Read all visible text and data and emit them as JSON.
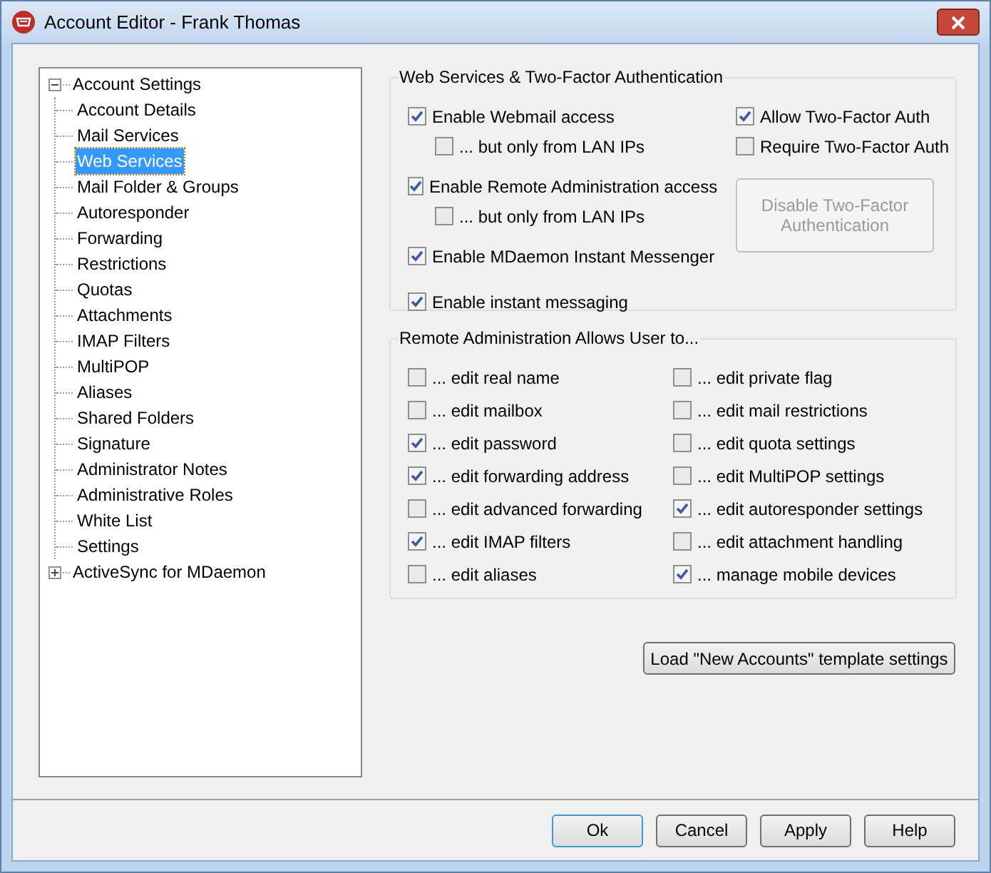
{
  "window": {
    "title": "Account Editor - Frank Thomas"
  },
  "tree": [
    {
      "label": "Account Settings",
      "expanded": true,
      "children": [
        {
          "label": "Account Details",
          "selected": false
        },
        {
          "label": "Mail Services",
          "selected": false
        },
        {
          "label": "Web Services",
          "selected": true
        },
        {
          "label": "Mail Folder & Groups",
          "selected": false
        },
        {
          "label": "Autoresponder",
          "selected": false
        },
        {
          "label": "Forwarding",
          "selected": false
        },
        {
          "label": "Restrictions",
          "selected": false
        },
        {
          "label": "Quotas",
          "selected": false
        },
        {
          "label": "Attachments",
          "selected": false
        },
        {
          "label": "IMAP Filters",
          "selected": false
        },
        {
          "label": "MultiPOP",
          "selected": false
        },
        {
          "label": "Aliases",
          "selected": false
        },
        {
          "label": "Shared Folders",
          "selected": false
        },
        {
          "label": "Signature",
          "selected": false
        },
        {
          "label": "Administrator Notes",
          "selected": false
        },
        {
          "label": "Administrative Roles",
          "selected": false
        },
        {
          "label": "White List",
          "selected": false
        },
        {
          "label": "Settings",
          "selected": false
        }
      ]
    },
    {
      "label": "ActiveSync for MDaemon",
      "expanded": false
    }
  ],
  "web_services": {
    "title": "Web Services & Two-Factor Authentication",
    "options": [
      {
        "label": "Enable Webmail access",
        "checked": true,
        "children": [
          {
            "label": "... but only from LAN IPs",
            "checked": false
          }
        ]
      },
      {
        "label": "Enable Remote Administration access",
        "checked": true,
        "children": [
          {
            "label": "... but only from LAN IPs",
            "checked": false
          }
        ]
      },
      {
        "label": "Enable MDaemon Instant Messenger",
        "checked": true
      },
      {
        "label": "Enable instant messaging",
        "checked": true
      }
    ],
    "two_factor": [
      {
        "label": "Allow Two-Factor Auth",
        "checked": true
      },
      {
        "label": "Require Two-Factor Auth",
        "checked": false
      }
    ],
    "disable_button": {
      "label": "Disable Two-Factor Authentication",
      "disabled": true
    }
  },
  "remote_admin": {
    "title": "Remote Administration Allows User to...",
    "left": [
      {
        "label": "... edit real name",
        "checked": false
      },
      {
        "label": "... edit mailbox",
        "checked": false
      },
      {
        "label": "... edit password",
        "checked": true
      },
      {
        "label": "... edit forwarding address",
        "checked": true
      },
      {
        "label": "... edit advanced forwarding",
        "checked": false
      },
      {
        "label": "... edit IMAP filters",
        "checked": true
      },
      {
        "label": "... edit aliases",
        "checked": false
      }
    ],
    "right": [
      {
        "label": "... edit private flag",
        "checked": false
      },
      {
        "label": "... edit mail restrictions",
        "checked": false
      },
      {
        "label": "... edit quota settings",
        "checked": false
      },
      {
        "label": "... edit MultiPOP settings",
        "checked": false
      },
      {
        "label": "... edit autoresponder settings",
        "checked": true
      },
      {
        "label": "... edit attachment handling",
        "checked": false
      },
      {
        "label": "... manage mobile devices",
        "checked": true
      }
    ]
  },
  "load_button": "Load \"New Accounts\" template settings",
  "buttons": [
    "Ok",
    "Cancel",
    "Apply",
    "Help"
  ]
}
